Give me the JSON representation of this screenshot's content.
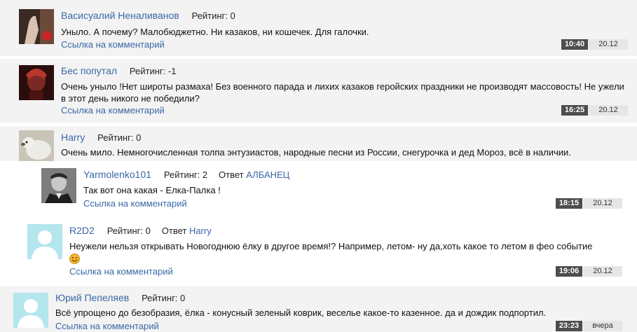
{
  "comments": [
    {
      "author": "Васисуалий Неналиванов",
      "rating_label": "Рейтинг: 0",
      "text": "Уныло. А почему? Малобюджетно. Ни казаков, ни кошечек. Для галочки.",
      "link": "Ссылка на комментарий",
      "time": "10:40",
      "date": "20.12"
    },
    {
      "author": "Бес попутал",
      "rating_label": "Рейтинг: -1",
      "text": "Очень уныло !Нет широты размаха! Без военного парада и лихих казаков геройских праздники не производят массовость! Не ужели в этот день никого не победили?",
      "link": "Ссылка на комментарий",
      "time": "16:25",
      "date": "20.12"
    },
    {
      "author": "Harry",
      "rating_label": "Рейтинг: 0",
      "text": "Очень мило. Немногочисленная толпа энтузиастов, народные песни из России, снегурочка и дед Мороз, всё в наличии."
    },
    {
      "author": "Yarmolenko101",
      "rating_label": "Рейтинг: 2",
      "reply_label": "Ответ",
      "reply_to": "АЛБАНЕЦ",
      "text": "Так вот она какая - Елка-Палка !",
      "link": "Ссылка на комментарий",
      "time": "18:15",
      "date": "20.12"
    },
    {
      "author": "R2D2",
      "rating_label": "Рейтинг: 0",
      "reply_label": "Ответ",
      "reply_to": "Harry",
      "text": "Неужели нельзя открывать Новогоднюю ёлку в другое время!? Например, летом- ну да,хоть какое то летом в фео событие",
      "link": "Ссылка на комментарий",
      "time": "19:06",
      "date": "20.12"
    },
    {
      "author": "Юрий Пепеляев",
      "rating_label": "Рейтинг: 0",
      "text": "Всё упрощено до безобразия, ёлка - конусный зеленый коврик, веселье какое-то казенное. да и дождик подпортил.",
      "link": "Ссылка на комментарий",
      "time": "23:23",
      "date": "вчера"
    }
  ],
  "colors": {
    "link": "#3a68a5",
    "time_bg": "#4d4d4d",
    "date_bg": "#e6e6e6",
    "band_bg": "#f3f3f3"
  }
}
